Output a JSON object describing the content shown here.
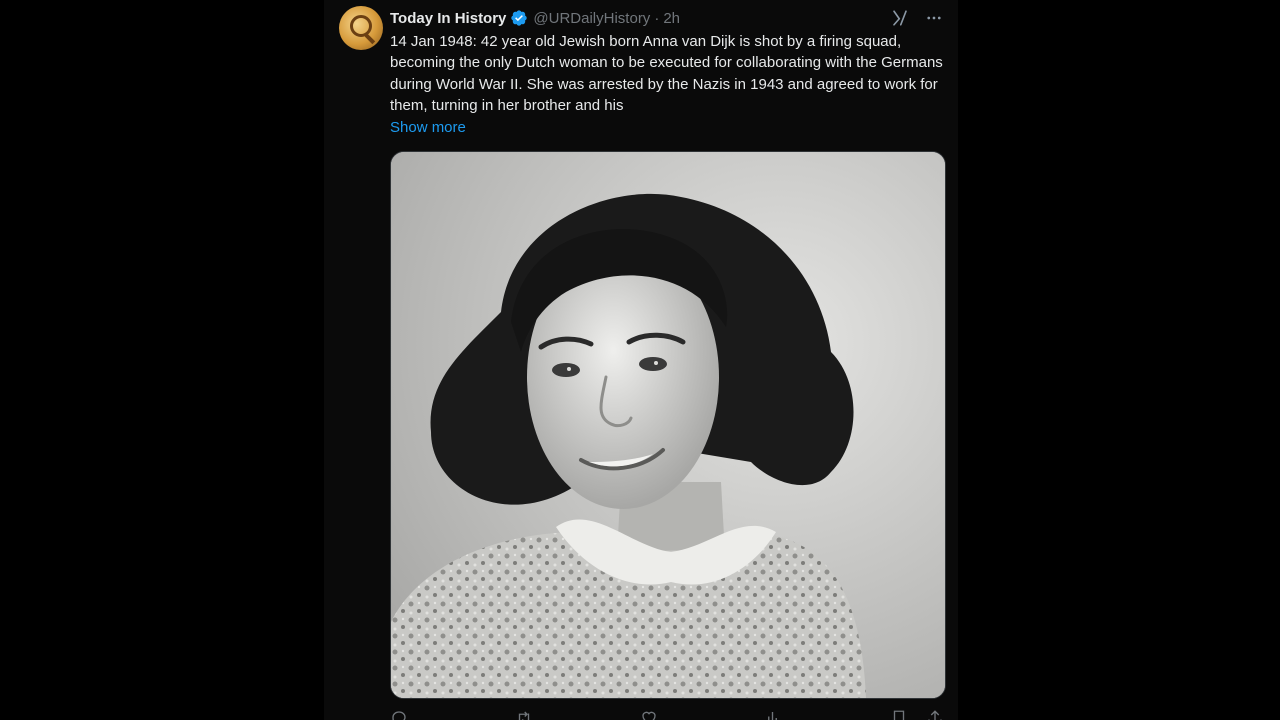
{
  "tweet": {
    "author": {
      "display_name": "Today In History",
      "handle": "@URDailyHistory",
      "avatar_icon": "magnifying-glass-icon",
      "verified_icon": "verified-badge-icon",
      "verified_color": "#1d9bf0"
    },
    "separator": "·",
    "timestamp": "2h",
    "text": "14 Jan 1948: 42 year old Jewish born Anna van Dijk is shot by a firing squad, becoming the only Dutch woman to be executed for collaborating with the Germans during World War II. She was arrested by the Nazis in 1943 and agreed to work for them, turning in her brother and his",
    "show_more_label": "Show more",
    "show_more_color": "#1d9bf0",
    "header_icons": [
      "grok-icon",
      "more-icon"
    ],
    "media_kind": "black-and-white-portrait-photo",
    "actions": {
      "reply_icon": "reply-icon",
      "retweet_icon": "retweet-icon",
      "like_icon": "heart-icon",
      "views_icon": "views-icon",
      "bookmark_icon": "bookmark-icon",
      "share_icon": "share-icon"
    }
  },
  "colors": {
    "background": "#000000",
    "column": "#0a0a0a",
    "text_primary": "#e7e9ea",
    "text_secondary": "#71767b",
    "accent": "#1d9bf0"
  }
}
